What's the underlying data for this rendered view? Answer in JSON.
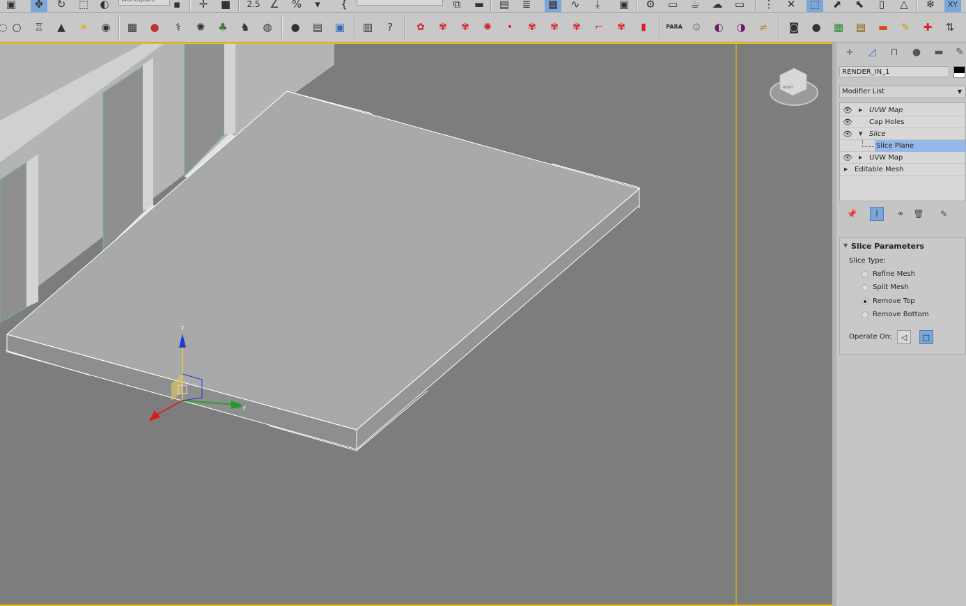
{
  "toolbar_top": {
    "workspace_value": "Workspace",
    "snap_angle": "2.5",
    "selection_set_value": ""
  },
  "toolbar_main": {
    "para_label": "PARA"
  },
  "viewport": {
    "viewcube_face": "RIGHT",
    "gizmo_axis_z": "z",
    "gizmo_axis_y": "y"
  },
  "command_panel": {
    "object_name": "RENDER_IN_1",
    "object_color": "#000000",
    "modifier_list_label": "Modifier List",
    "stack": [
      {
        "label": "UVW Map",
        "italic": true
      },
      {
        "label": "Cap Holes",
        "italic": false
      },
      {
        "label": "Slice",
        "italic": true
      },
      {
        "label": "Slice Plane",
        "selected": true
      },
      {
        "label": "UVW Map",
        "italic": false
      },
      {
        "label": "Editable Mesh",
        "italic": false
      }
    ],
    "rollout": {
      "title": "Slice Parameters",
      "slice_type_label": "Slice Type:",
      "options": [
        "Refine Mesh",
        "Split Mesh",
        "Remove Top",
        "Remove Bottom"
      ],
      "selected_option": "Remove Top",
      "operate_on_label": "Operate On:"
    }
  },
  "colors": {
    "viewport_bg": "#7d7d7d",
    "active_border": "#f2c200",
    "selection_highlight": "#94b8e8",
    "active_button": "#7aa7d8"
  }
}
